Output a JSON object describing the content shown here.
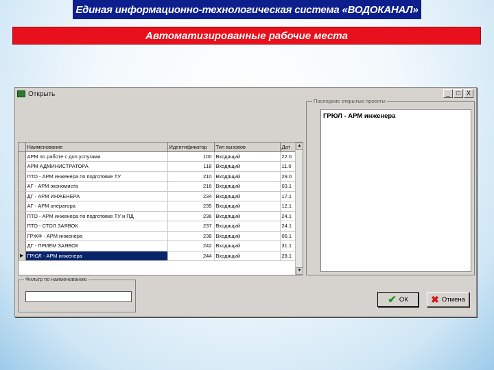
{
  "slide": {
    "header": "Единая информационно-технологическая система «ВОДОКАНАЛ»",
    "subheader": "Автоматизированные рабочие места"
  },
  "dialog": {
    "title": "Открыть",
    "window_buttons": [
      "_",
      "□",
      "X"
    ],
    "grid": {
      "columns": [
        "Наименование",
        "Идентификатор",
        "Тип вызовов",
        "Дат"
      ],
      "rows": [
        {
          "name": "АРМ по работе с доп.услугами",
          "id": "100",
          "type": "Входящий",
          "date": "22.0"
        },
        {
          "name": "АРМ АДМИНИСТРАТОРА",
          "id": "118",
          "type": "Входящий",
          "date": "11.0"
        },
        {
          "name": "ПТО - АРМ инженера по подготовке ТУ",
          "id": "210",
          "type": "Входящий",
          "date": "29.0"
        },
        {
          "name": "АГ - АРМ экономиста",
          "id": "216",
          "type": "Входящий",
          "date": "03.1"
        },
        {
          "name": "ДГ - АРМ ИНЖЕНЕРА",
          "id": "234",
          "type": "Входящий",
          "date": "17.1"
        },
        {
          "name": "АГ - АРМ оператора",
          "id": "235",
          "type": "Входящий",
          "date": "12.1"
        },
        {
          "name": "ПТО - АРМ инженера по подготовке ТУ и ПД",
          "id": "236",
          "type": "Входящий",
          "date": "24.1"
        },
        {
          "name": "ПТО - СТОЛ ЗАЯВОК",
          "id": "237",
          "type": "Входящий",
          "date": "24.1"
        },
        {
          "name": "ГРЖФ - АРМ инженера",
          "id": "238",
          "type": "Входящий",
          "date": "06.1"
        },
        {
          "name": "ДГ - ПРИЕМ ЗАЯВОК",
          "id": "242",
          "type": "Входящий",
          "date": "31.1"
        },
        {
          "name": "ГРЮЛ - АРМ инженера",
          "id": "244",
          "type": "Входящий",
          "date": "28.1"
        }
      ],
      "selected_index": 10,
      "row_pointer": "▶"
    },
    "recent": {
      "legend": "Последние открытые проекты",
      "items": [
        "ГРЮЛ - АРМ инженера"
      ]
    },
    "filter": {
      "legend": "Фильтр по наименованию",
      "value": ""
    },
    "ok_label": "ОК",
    "cancel_label": "Отмена"
  }
}
